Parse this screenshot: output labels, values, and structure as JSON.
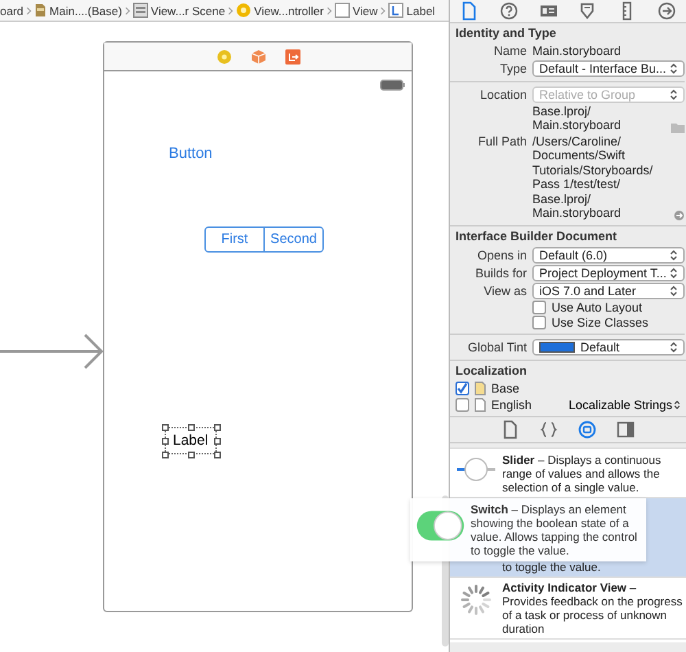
{
  "breadcrumb": [
    {
      "kind": "none",
      "label": "oard"
    },
    {
      "kind": "storyboard",
      "label": "Main....(Base)"
    },
    {
      "kind": "scene",
      "label": "View...r Scene"
    },
    {
      "kind": "controller",
      "label": "View...ntroller"
    },
    {
      "kind": "view",
      "label": "View"
    },
    {
      "kind": "label",
      "label": "Label"
    }
  ],
  "scene": {
    "button": "Button",
    "segments": [
      {
        "label": "First",
        "selected": false
      },
      {
        "label": "Second",
        "selected": false
      }
    ],
    "label": "Label",
    "label_selected": true
  },
  "inspector_tabs": [
    {
      "kind": "file",
      "selected": true
    },
    {
      "kind": "help",
      "selected": false
    },
    {
      "kind": "identity",
      "selected": false
    },
    {
      "kind": "attributes",
      "selected": false
    },
    {
      "kind": "size",
      "selected": false
    },
    {
      "kind": "connections",
      "selected": false
    }
  ],
  "identity": {
    "header": "Identity and Type",
    "name_label": "Name",
    "name": "Main.storyboard",
    "type_label": "Type",
    "type_value": "Default - Interface Bu...",
    "location_label": "Location",
    "location_value": "Relative to Group",
    "location_disabled": true,
    "relative_path": "Base.lproj/\nMain.storyboard",
    "full_path_label": "Full Path",
    "full_path": "/Users/Caroline/\nDocuments/Swift\nTutorials/Storyboards/\nPass 1/test/test/\nBase.lproj/\nMain.storyboard"
  },
  "ib_document": {
    "header": "Interface Builder Document",
    "opens_in_label": "Opens in",
    "opens_in": "Default (6.0)",
    "builds_for_label": "Builds for",
    "builds_for": "Project Deployment T...",
    "view_as_label": "View as",
    "view_as": "iOS 7.0 and Later",
    "options": [
      {
        "label": "Use Auto Layout",
        "checked": false
      },
      {
        "label": "Use Size Classes",
        "checked": false
      }
    ],
    "global_tint_label": "Global Tint",
    "global_tint": "Default"
  },
  "localization": {
    "header": "Localization",
    "items": [
      {
        "name": "Base",
        "checked": true
      },
      {
        "name": "English",
        "checked": false,
        "type": "Localizable Strings"
      }
    ]
  },
  "library_tabs": [
    {
      "kind": "file",
      "selected": false
    },
    {
      "kind": "code",
      "selected": false
    },
    {
      "kind": "object",
      "selected": true
    },
    {
      "kind": "media",
      "selected": false
    }
  ],
  "library_items": [
    {
      "kind": "slider",
      "text": "**Slider** – Displays a continuous range of values and allows the selection of a single value.",
      "selected": false
    },
    {
      "kind": "switch",
      "text": "to toggle the value.",
      "selected": true
    },
    {
      "kind": "activity",
      "text": "**Activity Indicator View** – Provides feedback on the progress of a task or process of unknown duration",
      "selected": false
    }
  ],
  "drag_preview": {
    "text": "**Switch** – Displays an element showing the boolean state of a value. Allows tapping the control to toggle the value.",
    "on": true
  }
}
